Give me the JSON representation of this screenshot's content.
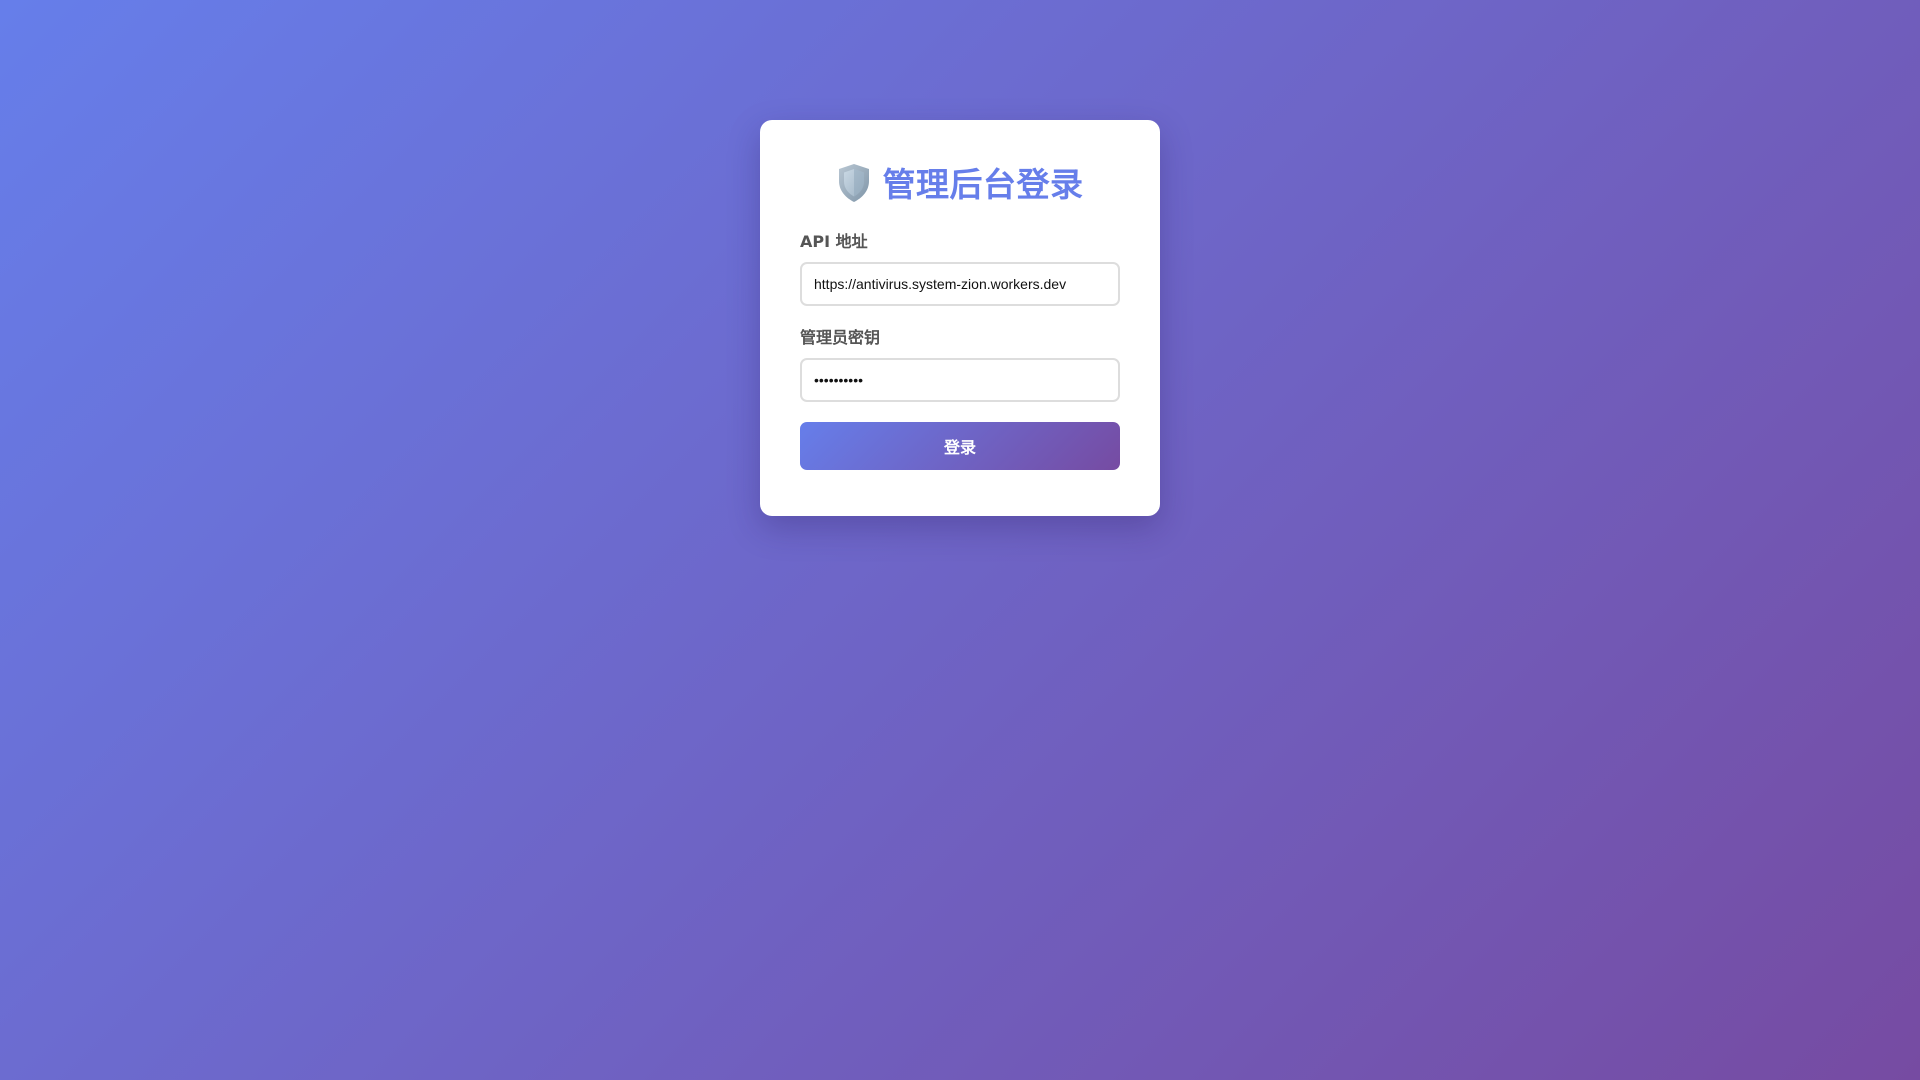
{
  "login": {
    "title": "管理后台登录",
    "icon": "shield-icon",
    "accent_color": "#667eea",
    "api_label": "API 地址",
    "api_value": "https://antivirus.system-zion.workers.dev",
    "key_label": "管理员密钥",
    "key_value": "••••••••••",
    "submit_label": "登录"
  }
}
